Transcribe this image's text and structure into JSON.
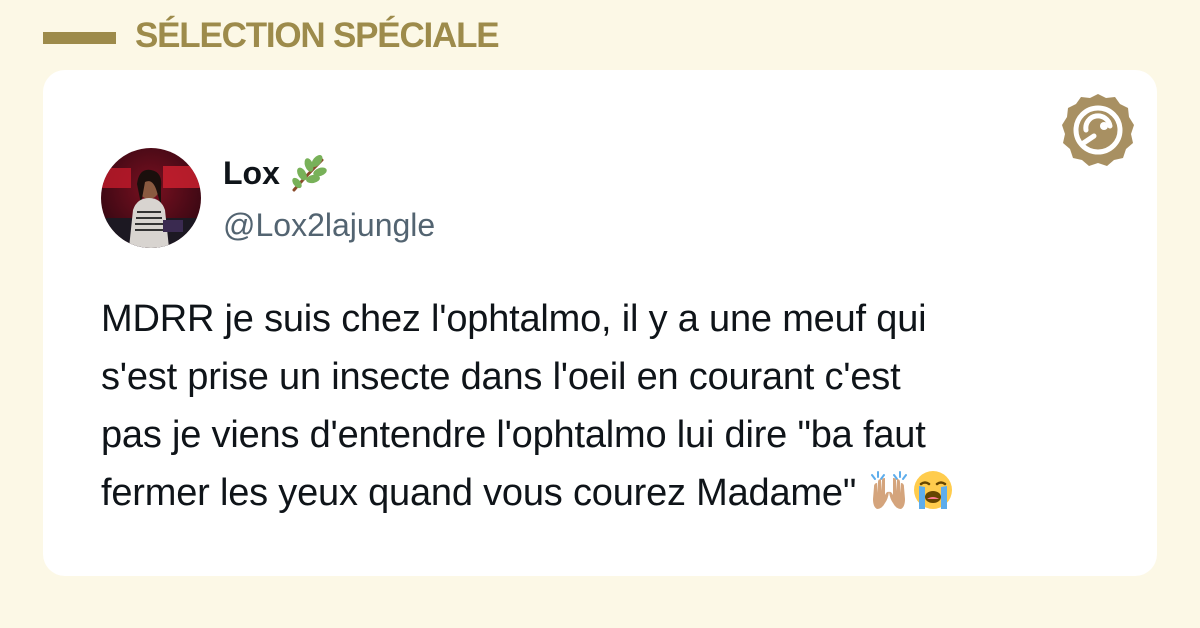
{
  "header": {
    "title": "SÉLECTION SPÉCIALE"
  },
  "colors": {
    "accent": "#9d8b4b",
    "background": "#fcf8e6",
    "card": "#ffffff",
    "text": "#0f1419",
    "handle": "#536471"
  },
  "tweet": {
    "author_name": "Lox",
    "author_name_emoji": "herb-branch-emoji",
    "author_handle": "@Lox2lajungle",
    "text_lines": [
      "MDRR je suis chez l'ophtalmo, il y a une meuf qui",
      "s'est prise un insecte dans l'oeil en courant c'est",
      "pas je viens d'entendre l'ophtalmo lui dire \"ba faut",
      "fermer les yeux quand vous courez Madame\""
    ],
    "trailing_emojis": [
      "raising-hands-emoji",
      "loudly-crying-face-emoji"
    ]
  },
  "brand": {
    "logo_icon": "brand-seal-icon"
  }
}
